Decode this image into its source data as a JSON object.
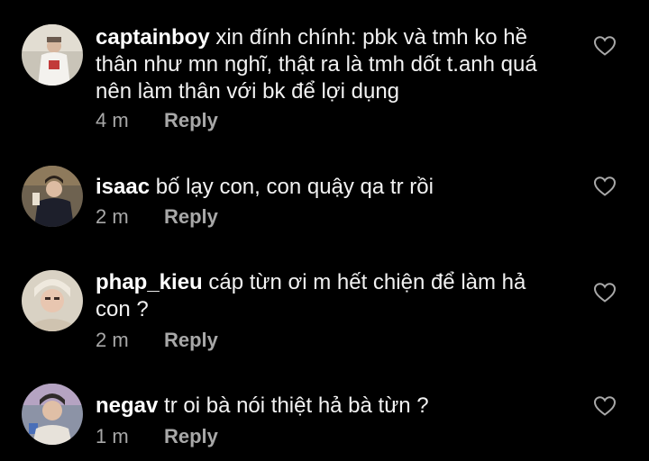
{
  "colors": {
    "background": "#000000",
    "text": "#f2f2f2",
    "secondary": "#a8a8a8"
  },
  "comments": [
    {
      "username": "captainboy",
      "text": "xin đính chính: pbk và tmh ko hề thân như mn nghĩ, thật ra là tmh dốt t.anh quá nên làm thân với bk để lợi dụng",
      "time": "4 m",
      "reply_label": "Reply",
      "like_icon": "heart-outline-icon"
    },
    {
      "username": "isaac",
      "text": "bố lạy con, con quậy qa tr rồi",
      "time": "2 m",
      "reply_label": "Reply",
      "like_icon": "heart-outline-icon"
    },
    {
      "username": "phap_kieu",
      "text": "cáp từn ơi m hết chiện để làm hả con ?",
      "time": "2 m",
      "reply_label": "Reply",
      "like_icon": "heart-outline-icon"
    },
    {
      "username": "negav",
      "text": "tr oi bà nói thiệt hả bà từn ?",
      "time": "1 m",
      "reply_label": "Reply",
      "like_icon": "heart-outline-icon"
    }
  ]
}
